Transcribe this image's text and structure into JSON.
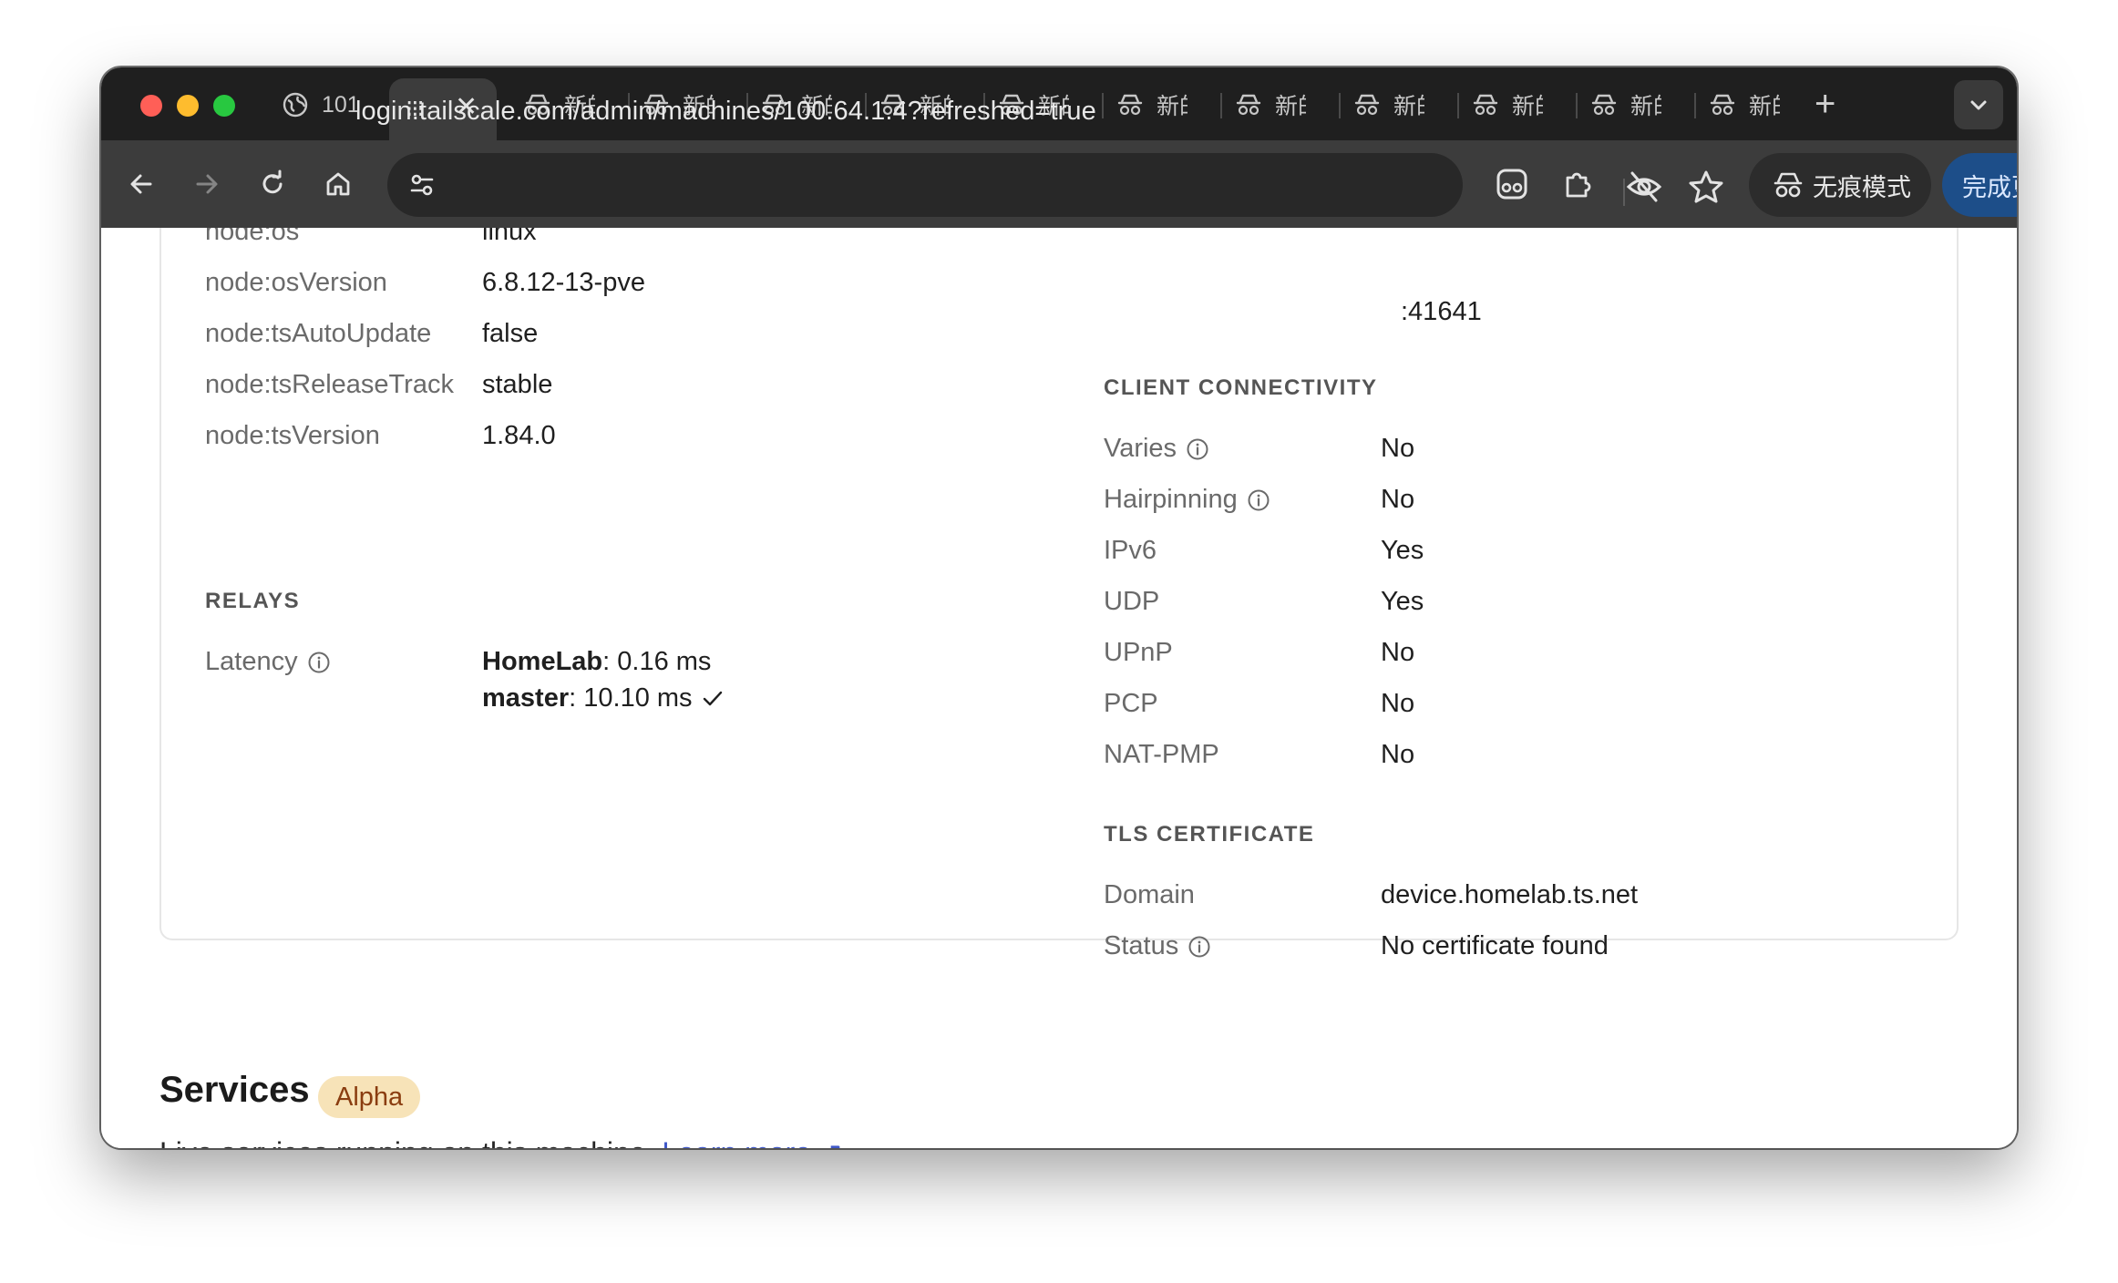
{
  "browser": {
    "tabs": [
      {
        "title": "101"
      },
      {
        "title": "新的"
      },
      {
        "title": "新的"
      },
      {
        "title": "新的"
      },
      {
        "title": "新的"
      },
      {
        "title": "新的"
      },
      {
        "title": "新的"
      },
      {
        "title": "新的"
      },
      {
        "title": "新的"
      },
      {
        "title": "新的"
      },
      {
        "title": "新的"
      },
      {
        "title": "新的"
      }
    ],
    "url": "login.tailscale.com/admin/machines/100.64.1.4?refreshed=true",
    "incognito_label": "无痕模式",
    "update_label": "完成更新"
  },
  "attributes": [
    {
      "key": "node:os",
      "value": "linux"
    },
    {
      "key": "node:osVersion",
      "value": "6.8.12-13-pve"
    },
    {
      "key": "node:tsAutoUpdate",
      "value": "false"
    },
    {
      "key": "node:tsReleaseTrack",
      "value": "stable"
    },
    {
      "key": "node:tsVersion",
      "value": "1.84.0"
    }
  ],
  "relays": {
    "heading": "RELAYS",
    "latency_label": "Latency",
    "entries": [
      {
        "name": "HomeLab",
        "value": "0.16 ms"
      },
      {
        "name": "master",
        "value": "10.10 ms"
      }
    ]
  },
  "endpoint_tail": ":41641",
  "connectivity": {
    "heading": "CLIENT CONNECTIVITY",
    "rows": [
      {
        "key": "Varies",
        "value": "No",
        "info": true
      },
      {
        "key": "Hairpinning",
        "value": "No",
        "info": true
      },
      {
        "key": "IPv6",
        "value": "Yes",
        "info": false
      },
      {
        "key": "UDP",
        "value": "Yes",
        "info": false
      },
      {
        "key": "UPnP",
        "value": "No",
        "info": false
      },
      {
        "key": "PCP",
        "value": "No",
        "info": false
      },
      {
        "key": "NAT-PMP",
        "value": "No",
        "info": false
      }
    ]
  },
  "tls": {
    "heading": "TLS CERTIFICATE",
    "rows": [
      {
        "key": "Domain",
        "value": "device.homelab.ts.net",
        "info": false
      },
      {
        "key": "Status",
        "value": "No certificate found",
        "info": true
      }
    ]
  },
  "services": {
    "title": "Services",
    "badge": "Alpha",
    "description": "Live services running on this machine.",
    "learn_more": "Learn more",
    "learn_more_arrow": "↗"
  },
  "colors": {
    "accent_link": "#3f58c9",
    "update_button": "#1d4e89",
    "badge_bg": "#f7e3b8",
    "badge_text": "#8a3d10"
  }
}
